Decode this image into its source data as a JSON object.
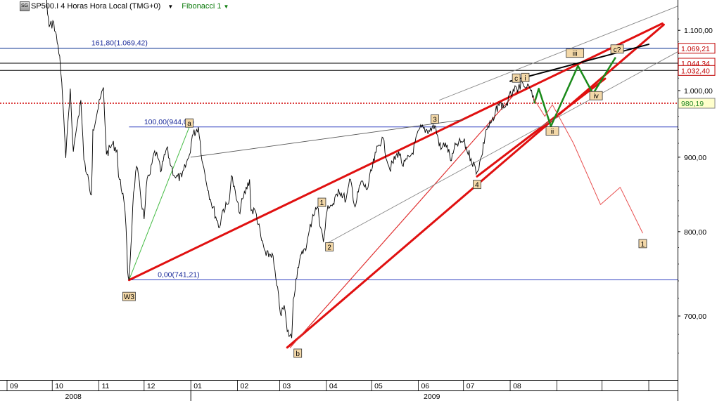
{
  "header": {
    "symbol_label": "SP500.I 4 Horas Hora Local (TMG+0)",
    "icon_text": "SG",
    "indicator_label": "Fibonacci 1"
  },
  "colors": {
    "price": "#000000",
    "trend_red": "#e01010",
    "thin_red": "#e03030",
    "fib_blue": "#3040c0",
    "green_path": "#1a8a1a",
    "green_ref": "#44bb44",
    "red_dotted": "#d00000",
    "label_bg": "#f3d8a8"
  },
  "chart_data": {
    "type": "line",
    "title": "",
    "xlabel": "",
    "ylabel": "",
    "y_scale": "log",
    "ylim": [
      640,
      1140
    ],
    "x_range": [
      "2008-09-01",
      "2009-11-15"
    ],
    "x_ticks": [
      {
        "date": "2008-09-01",
        "label": "09"
      },
      {
        "date": "2008-10-01",
        "label": "10"
      },
      {
        "date": "2008-11-01",
        "label": "11"
      },
      {
        "date": "2008-12-01",
        "label": "12"
      },
      {
        "date": "2009-01-01",
        "label": "01"
      },
      {
        "date": "2009-02-01",
        "label": "02"
      },
      {
        "date": "2009-03-01",
        "label": "03"
      },
      {
        "date": "2009-04-01",
        "label": "04"
      },
      {
        "date": "2009-05-01",
        "label": "05"
      },
      {
        "date": "2009-06-01",
        "label": "06"
      },
      {
        "date": "2009-07-01",
        "label": "07"
      },
      {
        "date": "2009-08-01",
        "label": "08"
      },
      {
        "date": "2009-09-01",
        "label": ""
      },
      {
        "date": "2009-10-01",
        "label": ""
      },
      {
        "date": "2009-11-01",
        "label": ""
      }
    ],
    "year_labels": [
      {
        "date": "2008-10-15",
        "label": "2008"
      },
      {
        "date": "2009-06-10",
        "label": "2009"
      }
    ],
    "y_ticks": [
      {
        "value": 1100,
        "label": "1.100,00"
      },
      {
        "value": 1000,
        "label": "1.000,00"
      },
      {
        "value": 900,
        "label": "900,00"
      },
      {
        "value": 800,
        "label": "800,00"
      },
      {
        "value": 700,
        "label": "700,00"
      }
    ],
    "price_labels": [
      {
        "value": 1069.21,
        "text": "1.069,21",
        "bg": "#ffffff",
        "fg": "#c00000",
        "border": "#c00000"
      },
      {
        "value": 1044.34,
        "text": "1.044,34",
        "bg": "#ffffff",
        "fg": "#c00000",
        "border": "#c00000"
      },
      {
        "value": 1032.4,
        "text": "1.032,40",
        "bg": "#ffffff",
        "fg": "#c00000",
        "border": "#c00000"
      },
      {
        "value": 980.19,
        "text": "980,19",
        "bg": "#ffffcc",
        "fg": "#2a8a2a",
        "border": "#888888"
      }
    ],
    "fibonacci": {
      "levels": [
        {
          "value": 1069.42,
          "text": "161,80(1.069,42)",
          "label_date": "2008-10-27"
        },
        {
          "value": 944.06,
          "text": "100,00(944,06)",
          "label_date": "2008-12-01"
        },
        {
          "value": 741.21,
          "text": "0,00(741,21)",
          "label_date": "2008-12-10"
        }
      ],
      "start_date": "2008-11-21",
      "guide_line": [
        [
          "2008-11-21",
          741.21
        ],
        [
          "2008-12-31",
          944.06
        ]
      ]
    },
    "horizontal_lines": [
      {
        "value": 1069.21,
        "color": "#3a9a3a",
        "from": "2008-09-01"
      },
      {
        "value": 1044.34,
        "color": "#000000",
        "from": "2008-09-01"
      },
      {
        "value": 1032.4,
        "color": "#000000",
        "from": "2008-09-01"
      },
      {
        "value": 980.19,
        "color": "#d00000",
        "from": "2008-09-01",
        "dashed": true
      }
    ],
    "series": [
      {
        "kind": "price",
        "points": [
          [
            "2008-09-01",
            1282
          ],
          [
            "2008-09-05",
            1245
          ],
          [
            "2008-09-10",
            1232
          ],
          [
            "2008-09-15",
            1192
          ],
          [
            "2008-09-19",
            1255
          ],
          [
            "2008-09-25",
            1209
          ],
          [
            "2008-09-29",
            1106
          ],
          [
            "2008-10-02",
            1114
          ],
          [
            "2008-10-06",
            1056
          ],
          [
            "2008-10-08",
            984
          ],
          [
            "2008-10-10",
            899
          ],
          [
            "2008-10-13",
            1003
          ],
          [
            "2008-10-15",
            908
          ],
          [
            "2008-10-17",
            940
          ],
          [
            "2008-10-20",
            985
          ],
          [
            "2008-10-22",
            896
          ],
          [
            "2008-10-24",
            876
          ],
          [
            "2008-10-27",
            848
          ],
          [
            "2008-10-28",
            940
          ],
          [
            "2008-10-31",
            968
          ],
          [
            "2008-11-04",
            1005
          ],
          [
            "2008-11-06",
            904
          ],
          [
            "2008-11-10",
            919
          ],
          [
            "2008-11-13",
            911
          ],
          [
            "2008-11-14",
            873
          ],
          [
            "2008-11-17",
            850
          ],
          [
            "2008-11-19",
            806
          ],
          [
            "2008-11-20",
            752
          ],
          [
            "2008-11-21",
            741
          ],
          [
            "2008-11-24",
            851
          ],
          [
            "2008-11-26",
            887
          ],
          [
            "2008-12-01",
            816
          ],
          [
            "2008-12-03",
            870
          ],
          [
            "2008-12-05",
            876
          ],
          [
            "2008-12-08",
            909
          ],
          [
            "2008-12-10",
            899
          ],
          [
            "2008-12-12",
            879
          ],
          [
            "2008-12-16",
            913
          ],
          [
            "2008-12-19",
            887
          ],
          [
            "2008-12-22",
            871
          ],
          [
            "2008-12-26",
            872
          ],
          [
            "2008-12-31",
            903
          ],
          [
            "2009-01-02",
            931
          ],
          [
            "2009-01-06",
            944
          ],
          [
            "2009-01-09",
            890
          ],
          [
            "2009-01-14",
            842
          ],
          [
            "2009-01-20",
            805
          ],
          [
            "2009-01-22",
            827
          ],
          [
            "2009-01-26",
            836
          ],
          [
            "2009-01-28",
            874
          ],
          [
            "2009-02-02",
            825
          ],
          [
            "2009-02-05",
            845
          ],
          [
            "2009-02-09",
            869
          ],
          [
            "2009-02-10",
            827
          ],
          [
            "2009-02-13",
            826
          ],
          [
            "2009-02-17",
            789
          ],
          [
            "2009-02-20",
            770
          ],
          [
            "2009-02-24",
            773
          ],
          [
            "2009-02-27",
            735
          ],
          [
            "2009-03-02",
            700
          ],
          [
            "2009-03-04",
            712
          ],
          [
            "2009-03-06",
            683
          ],
          [
            "2009-03-09",
            676
          ],
          [
            "2009-03-10",
            719
          ],
          [
            "2009-03-13",
            756
          ],
          [
            "2009-03-17",
            778
          ],
          [
            "2009-03-19",
            784
          ],
          [
            "2009-03-23",
            822
          ],
          [
            "2009-03-26",
            832
          ],
          [
            "2009-03-30",
            787
          ],
          [
            "2009-04-02",
            834
          ],
          [
            "2009-04-06",
            835
          ],
          [
            "2009-04-09",
            856
          ],
          [
            "2009-04-14",
            841
          ],
          [
            "2009-04-17",
            869
          ],
          [
            "2009-04-20",
            832
          ],
          [
            "2009-04-24",
            866
          ],
          [
            "2009-04-28",
            855
          ],
          [
            "2009-05-04",
            907
          ],
          [
            "2009-05-08",
            929
          ],
          [
            "2009-05-13",
            883
          ],
          [
            "2009-05-19",
            908
          ],
          [
            "2009-05-22",
            887
          ],
          [
            "2009-05-28",
            906
          ],
          [
            "2009-06-02",
            942
          ],
          [
            "2009-06-08",
            939
          ],
          [
            "2009-06-12",
            946
          ],
          [
            "2009-06-16",
            911
          ],
          [
            "2009-06-19",
            921
          ],
          [
            "2009-06-23",
            895
          ],
          [
            "2009-06-26",
            918
          ],
          [
            "2009-07-01",
            923
          ],
          [
            "2009-07-06",
            898
          ],
          [
            "2009-07-10",
            879
          ],
          [
            "2009-07-13",
            901
          ],
          [
            "2009-07-16",
            940
          ],
          [
            "2009-07-21",
            954
          ],
          [
            "2009-07-24",
            979
          ],
          [
            "2009-07-29",
            975
          ],
          [
            "2009-08-03",
            1002
          ],
          [
            "2009-08-06",
            997
          ],
          [
            "2009-08-07",
            1010
          ],
          [
            "2009-08-10",
            1007
          ],
          [
            "2009-08-12",
            1005
          ],
          [
            "2009-08-14",
            1004
          ],
          [
            "2009-08-17",
            980
          ]
        ]
      },
      {
        "kind": "forecast_green",
        "points": [
          [
            "2009-08-17",
            980
          ],
          [
            "2009-08-20",
            1003
          ],
          [
            "2009-08-28",
            945
          ],
          [
            "2009-09-15",
            1040
          ],
          [
            "2009-09-25",
            995
          ],
          [
            "2009-10-10",
            1054
          ]
        ]
      },
      {
        "kind": "forecast_red",
        "points": [
          [
            "2009-08-16",
            990
          ],
          [
            "2009-08-24",
            960
          ],
          [
            "2009-08-29",
            978
          ],
          [
            "2009-09-12",
            920
          ],
          [
            "2009-09-30",
            835
          ],
          [
            "2009-10-13",
            858
          ],
          [
            "2009-10-28",
            798
          ]
        ]
      }
    ],
    "trendlines": [
      {
        "from": [
          "2008-11-21",
          741
        ],
        "to": [
          "2009-11-10",
          1112
        ],
        "color": "#e01010",
        "width": 3
      },
      {
        "from": [
          "2009-03-06",
          666
        ],
        "to": [
          "2009-11-11",
          1110
        ],
        "color": "#e01010",
        "width": 3
      },
      {
        "from": [
          "2009-03-08",
          666
        ],
        "to": [
          "2009-08-06",
          1000
        ],
        "color": "#e03030",
        "width": 1.2
      },
      {
        "from": [
          "2009-07-10",
          873
        ],
        "to": [
          "2009-10-03",
          1019
        ],
        "color": "#e01010",
        "width": 3
      },
      {
        "from": [
          "2009-08-01",
          1015
        ],
        "to": [
          "2009-11-01",
          1076
        ],
        "color": "#000000",
        "width": 2
      },
      {
        "from": [
          "2009-01-01",
          900
        ],
        "to": [
          "2009-07-01",
          955
        ],
        "color": "#555555",
        "width": 0.9
      },
      {
        "from": [
          "2009-06-15",
          985
        ],
        "to": [
          "2009-11-25",
          1148
        ],
        "color": "#888888",
        "width": 0.9
      },
      {
        "from": [
          "2009-04-01",
          785
        ],
        "to": [
          "2009-11-25",
          1070
        ],
        "color": "#888888",
        "width": 0.9
      }
    ],
    "wave_labels": [
      {
        "date": "2008-11-21",
        "value": 722,
        "text": "W3"
      },
      {
        "date": "2008-12-31",
        "value": 950,
        "text": "a"
      },
      {
        "date": "2009-03-13",
        "value": 660,
        "text": "b"
      },
      {
        "date": "2009-03-29",
        "value": 838,
        "text": "1"
      },
      {
        "date": "2009-04-03",
        "value": 781,
        "text": "2"
      },
      {
        "date": "2009-06-12",
        "value": 956,
        "text": "3"
      },
      {
        "date": "2009-07-10",
        "value": 862,
        "text": "4"
      },
      {
        "date": "2009-08-05",
        "value": 1020,
        "text": "c"
      },
      {
        "date": "2009-08-11",
        "value": 1021,
        "text": "i"
      },
      {
        "date": "2009-08-29",
        "value": 938,
        "text": "ii"
      },
      {
        "date": "2009-09-13",
        "value": 1061,
        "text": "iii"
      },
      {
        "date": "2009-09-27",
        "value": 992,
        "text": "iv"
      },
      {
        "date": "2009-10-11",
        "value": 1068,
        "text": "c?"
      },
      {
        "date": "2009-10-28",
        "value": 785,
        "text": "1"
      }
    ]
  }
}
